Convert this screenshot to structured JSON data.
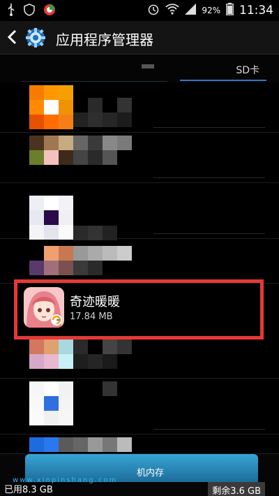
{
  "statusbar": {
    "battery": "92%",
    "time": "11:34"
  },
  "header": {
    "title": "应用程序管理器"
  },
  "tabs": {
    "active_label": "SD卡"
  },
  "apps": [
    {
      "name": "奇迹暖暖",
      "size": "17.84 MB"
    }
  ],
  "storage": {
    "label": "机内存",
    "used": "已用8.3 GB",
    "free": "剩余3.6 GB",
    "used_fraction": 0.7,
    "watermark": "www.xinpinshang.com"
  },
  "colors": {
    "highlight": "#e53935",
    "accent": "#2c7cc4",
    "storage": "#37a5d6"
  }
}
